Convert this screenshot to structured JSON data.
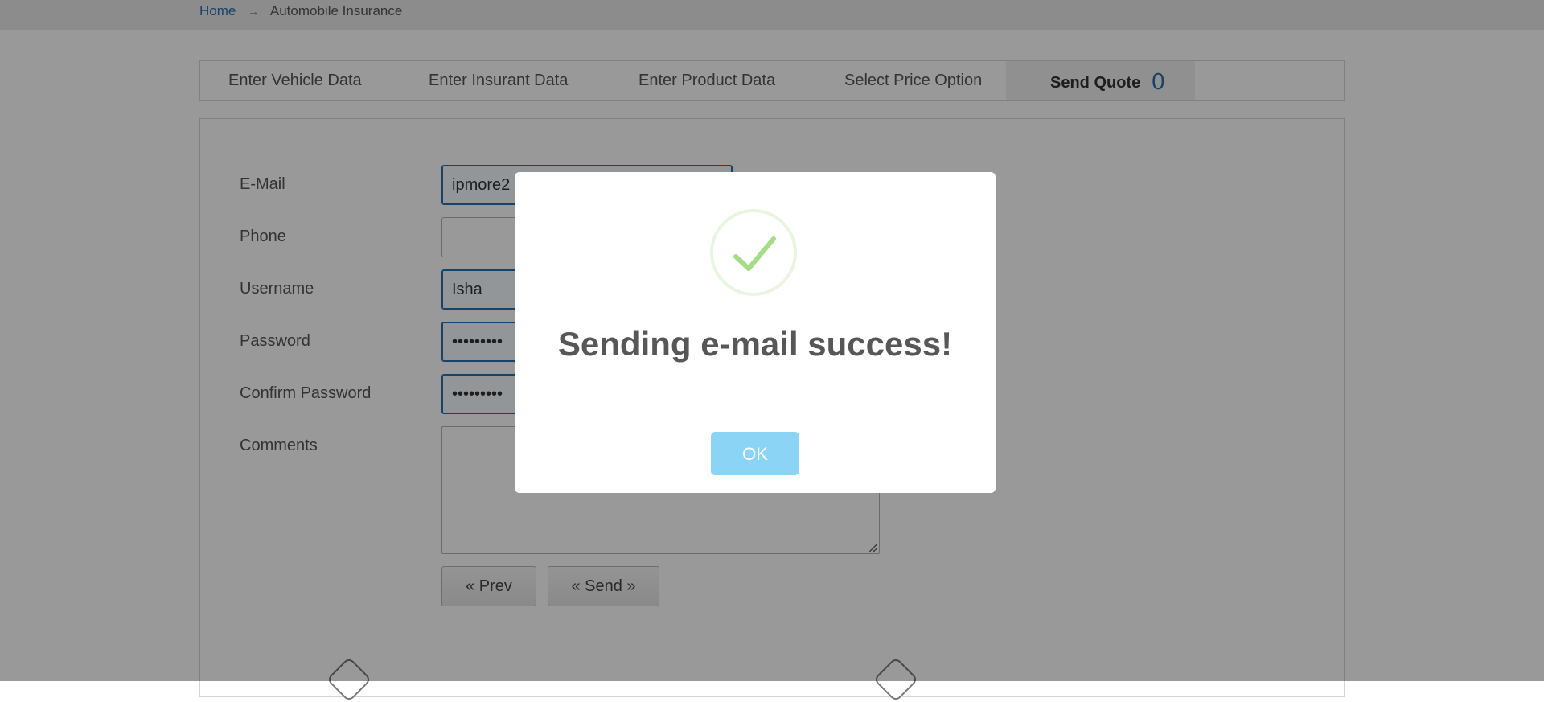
{
  "breadcrumb": {
    "home": "Home",
    "separator": "→",
    "current": "Automobile Insurance"
  },
  "tabs": [
    {
      "label": "Enter Vehicle Data"
    },
    {
      "label": "Enter Insurant Data"
    },
    {
      "label": "Enter Product Data"
    },
    {
      "label": "Select Price Option"
    },
    {
      "label": "Send Quote",
      "count": "0",
      "active": true
    }
  ],
  "form": {
    "email_label": "E-Mail",
    "email_value": "ipmore2",
    "phone_label": "Phone",
    "phone_value": "",
    "username_label": "Username",
    "username_value": "Isha",
    "password_label": "Password",
    "password_value": "•••••••••",
    "confirm_password_label": "Confirm Password",
    "confirm_password_value": "•••••••••",
    "comments_label": "Comments",
    "comments_value": ""
  },
  "buttons": {
    "prev": "« Prev",
    "send": "« Send »"
  },
  "modal": {
    "title": "Sending e-mail success!",
    "ok": "OK",
    "icon": "checkmark-icon"
  },
  "colors": {
    "accent": "#2a6fb0",
    "ok_button": "#8cd4f5",
    "success_check": "#a5dc86"
  }
}
